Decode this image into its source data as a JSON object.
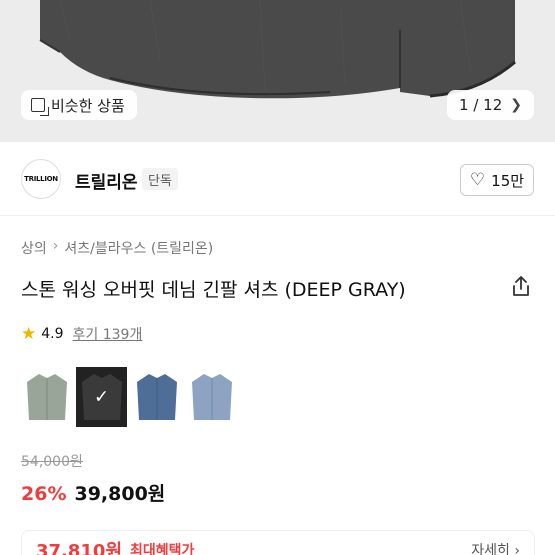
{
  "hero": {
    "similar_label": "비슷한 상품",
    "page_current": "1",
    "page_total": "12",
    "page_text": "1 / 12"
  },
  "brand": {
    "logo_text": "TRILLION",
    "name": "트릴리온",
    "badge": "단독",
    "likes": "15만"
  },
  "breadcrumb": {
    "items": [
      "상의",
      "셔츠/블라우스 (트릴리온)"
    ]
  },
  "product": {
    "title": "스톤 워싱 오버핏 데님 긴팔 셔츠 (DEEP GRAY)",
    "rating": "4.9",
    "reviews": "후기 139개",
    "original_price": "54,000원",
    "discount": "26%",
    "price": "39,800원"
  },
  "swatches": [
    {
      "color": "#9aa599",
      "selected": false
    },
    {
      "color": "#2b2b2b",
      "selected": true
    },
    {
      "color": "#4e6e98",
      "selected": false
    },
    {
      "color": "#8ea2c2",
      "selected": false
    }
  ],
  "benefit": {
    "price": "37,810원",
    "label": "최대혜택가",
    "detail": "자세히 ›"
  },
  "colors": {
    "accent_red": "#f03c3c",
    "star": "#f4b400"
  }
}
